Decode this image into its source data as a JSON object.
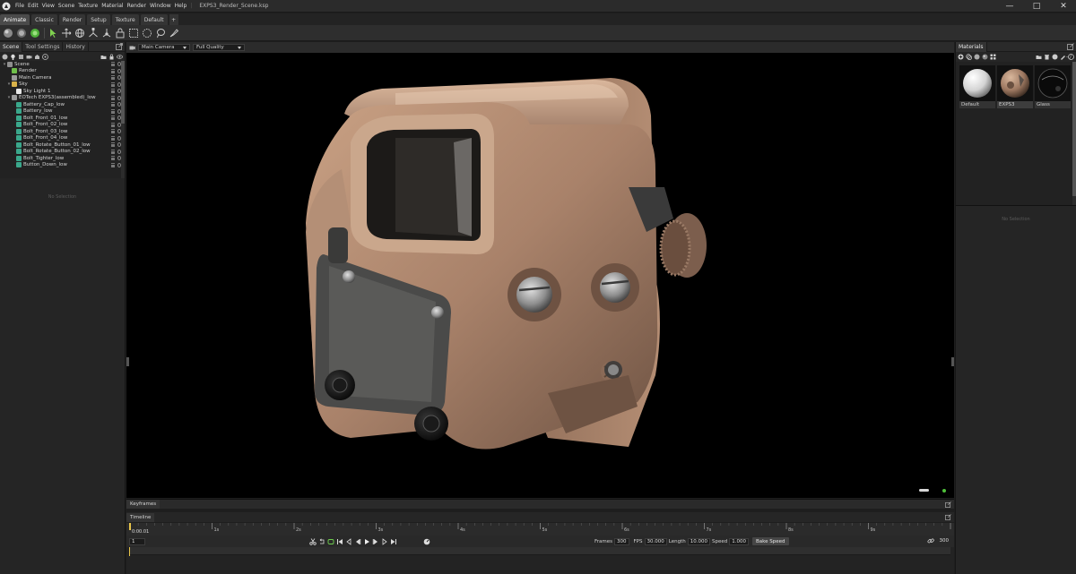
{
  "menubar": {
    "items": [
      "File",
      "Edit",
      "View",
      "Scene",
      "Texture",
      "Material",
      "Render",
      "Window",
      "Help"
    ],
    "document_title": "EXPS3_Render_Scene.ksp"
  },
  "mode_tabs": [
    "Animate",
    "Classic",
    "Render",
    "Setup",
    "Texture",
    "Default"
  ],
  "mode_add": "+",
  "left_panel": {
    "tabs": [
      "Scene",
      "Tool Settings",
      "History"
    ],
    "tree": [
      {
        "label": "Scene",
        "depth": 0,
        "icon": "scene-icon",
        "color": "#8f8f8f"
      },
      {
        "label": "Render",
        "depth": 1,
        "icon": "render-icon",
        "color": "#6fbf4a"
      },
      {
        "label": "Main Camera",
        "depth": 1,
        "icon": "camera-icon",
        "color": "#9a9a9a"
      },
      {
        "label": "Sky",
        "depth": 1,
        "icon": "sky-icon",
        "color": "#d9b24a"
      },
      {
        "label": "Sky Light 1",
        "depth": 2,
        "icon": "light-icon",
        "color": "#e6e6e6"
      },
      {
        "label": "EOTech EXPS3(assembled)_low",
        "depth": 1,
        "icon": "group-icon",
        "color": "#9a9a9a"
      },
      {
        "label": "Battery_Cap_low",
        "depth": 2,
        "icon": "mesh-icon",
        "color": "#3aa88c"
      },
      {
        "label": "Battery_low",
        "depth": 2,
        "icon": "mesh-icon",
        "color": "#3aa88c"
      },
      {
        "label": "Bolt_Front_01_low",
        "depth": 2,
        "icon": "mesh-icon",
        "color": "#3aa88c"
      },
      {
        "label": "Bolt_Front_02_low",
        "depth": 2,
        "icon": "mesh-icon",
        "color": "#3aa88c"
      },
      {
        "label": "Bolt_Front_03_low",
        "depth": 2,
        "icon": "mesh-icon",
        "color": "#3aa88c"
      },
      {
        "label": "Bolt_Front_04_low",
        "depth": 2,
        "icon": "mesh-icon",
        "color": "#3aa88c"
      },
      {
        "label": "Bolt_Rotate_Button_01_low",
        "depth": 2,
        "icon": "mesh-icon",
        "color": "#3aa88c"
      },
      {
        "label": "Bolt_Rotate_Button_02_low",
        "depth": 2,
        "icon": "mesh-icon",
        "color": "#3aa88c"
      },
      {
        "label": "Bolt_Tighter_low",
        "depth": 2,
        "icon": "mesh-icon",
        "color": "#3aa88c"
      },
      {
        "label": "Button_Down_low",
        "depth": 2,
        "icon": "mesh-icon",
        "color": "#3aa88c"
      }
    ],
    "no_selection": "No Selection"
  },
  "viewport": {
    "camera": "Main Camera",
    "quality": "Full Quality"
  },
  "keyframes_tab": "Keyframes",
  "timeline": {
    "tab": "Timeline",
    "current_time": "0:00.01",
    "current_frame": "1",
    "ruler_labels": [
      "1s",
      "2s",
      "3s",
      "4s",
      "5s",
      "6s",
      "7s",
      "8s",
      "9s"
    ],
    "frames_label": "Frames",
    "frames_value": "300",
    "fps_label": "FPS",
    "fps_value": "30.000",
    "length_label": "Length",
    "length_value": "10.000",
    "speed_label": "Speed",
    "speed_value": "1.000",
    "bake_speed": "Bake Speed",
    "end_frame": "300"
  },
  "right_panel": {
    "tab": "Materials",
    "search_label": "- /",
    "materials": [
      {
        "name": "Default",
        "kind": "default"
      },
      {
        "name": "EXPS3",
        "kind": "exps3"
      },
      {
        "name": "Glass",
        "kind": "glass"
      }
    ],
    "no_selection": "No Selection"
  }
}
